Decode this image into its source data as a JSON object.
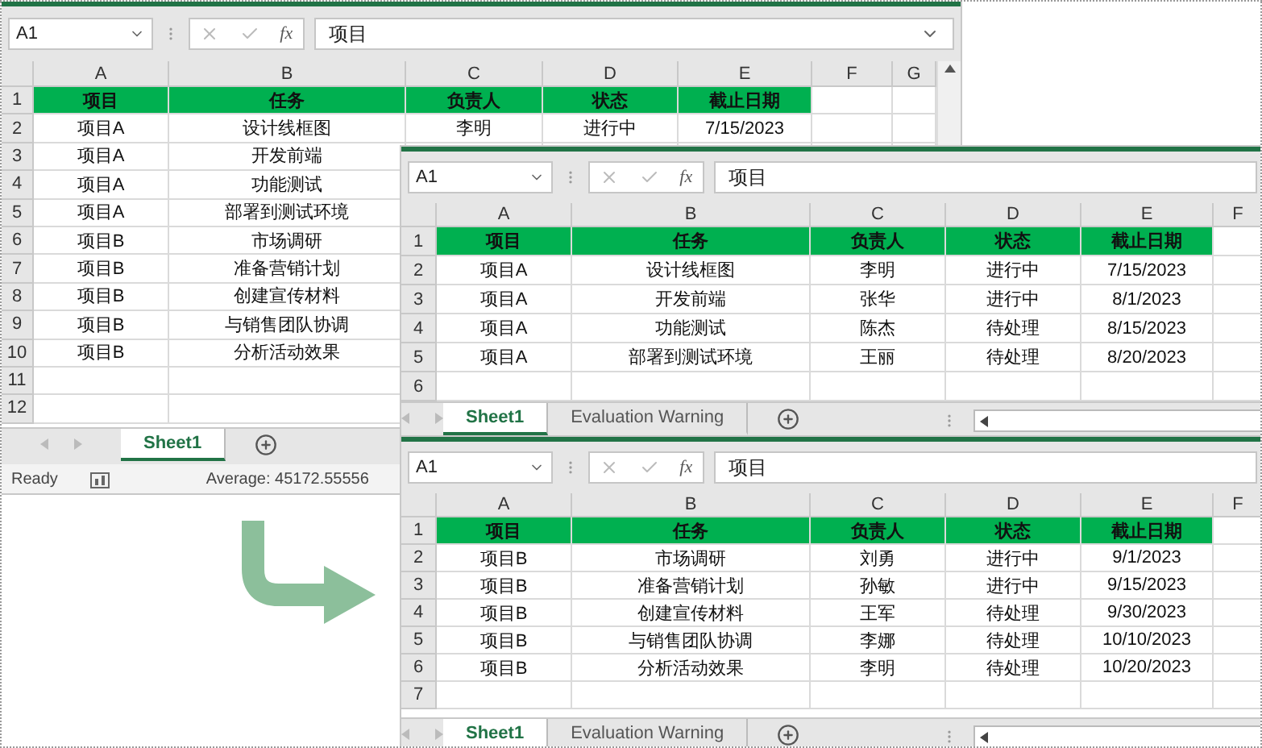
{
  "windows": [
    {
      "formula_bar": {
        "name_box": "A1",
        "function_label": "fx",
        "value": "项目"
      },
      "columns": [
        "A",
        "B",
        "C",
        "D",
        "E",
        "F",
        "G"
      ],
      "rows": [
        {
          "number": "1",
          "kind": "header",
          "cells": [
            "项目",
            "任务",
            "负责人",
            "状态",
            "截止日期"
          ]
        },
        {
          "number": "2",
          "kind": "data",
          "cells": [
            "项目A",
            "设计线框图",
            "李明",
            "进行中",
            "7/15/2023"
          ]
        },
        {
          "number": "3",
          "kind": "data",
          "cells": [
            "项目A",
            "开发前端"
          ]
        },
        {
          "number": "4",
          "kind": "data",
          "cells": [
            "项目A",
            "功能测试"
          ]
        },
        {
          "number": "5",
          "kind": "data",
          "cells": [
            "项目A",
            "部署到测试环境"
          ]
        },
        {
          "number": "6",
          "kind": "data",
          "cells": [
            "项目B",
            "市场调研"
          ]
        },
        {
          "number": "7",
          "kind": "data",
          "cells": [
            "项目B",
            "准备营销计划"
          ]
        },
        {
          "number": "8",
          "kind": "data",
          "cells": [
            "项目B",
            "创建宣传材料"
          ]
        },
        {
          "number": "9",
          "kind": "data",
          "cells": [
            "项目B",
            "与销售团队协调"
          ]
        },
        {
          "number": "10",
          "kind": "data",
          "cells": [
            "项目B",
            "分析活动效果"
          ]
        },
        {
          "number": "11",
          "kind": "data",
          "cells": []
        },
        {
          "number": "12",
          "kind": "data",
          "cells": []
        }
      ],
      "sheet_tabs": [
        {
          "label": "Sheet1",
          "selected": true
        }
      ],
      "status_bar": {
        "mode": "Ready",
        "summary": "Average: 45172.55556"
      }
    },
    {
      "formula_bar": {
        "name_box": "A1",
        "function_label": "fx",
        "value": "项目"
      },
      "columns": [
        "A",
        "B",
        "C",
        "D",
        "E",
        "F"
      ],
      "rows": [
        {
          "number": "1",
          "kind": "header",
          "cells": [
            "项目",
            "任务",
            "负责人",
            "状态",
            "截止日期"
          ]
        },
        {
          "number": "2",
          "kind": "data",
          "cells": [
            "项目A",
            "设计线框图",
            "李明",
            "进行中",
            "7/15/2023"
          ]
        },
        {
          "number": "3",
          "kind": "data",
          "cells": [
            "项目A",
            "开发前端",
            "张华",
            "进行中",
            "8/1/2023"
          ]
        },
        {
          "number": "4",
          "kind": "data",
          "cells": [
            "项目A",
            "功能测试",
            "陈杰",
            "待处理",
            "8/15/2023"
          ]
        },
        {
          "number": "5",
          "kind": "data",
          "cells": [
            "项目A",
            "部署到测试环境",
            "王丽",
            "待处理",
            "8/20/2023"
          ]
        },
        {
          "number": "6",
          "kind": "data",
          "cells": []
        }
      ],
      "sheet_tabs": [
        {
          "label": "Sheet1",
          "selected": true
        },
        {
          "label": "Evaluation Warning",
          "selected": false
        }
      ]
    },
    {
      "formula_bar": {
        "name_box": "A1",
        "function_label": "fx",
        "value": "项目"
      },
      "columns": [
        "A",
        "B",
        "C",
        "D",
        "E",
        "F"
      ],
      "rows": [
        {
          "number": "1",
          "kind": "header",
          "cells": [
            "项目",
            "任务",
            "负责人",
            "状态",
            "截止日期"
          ]
        },
        {
          "number": "2",
          "kind": "data",
          "cells": [
            "项目B",
            "市场调研",
            "刘勇",
            "进行中",
            "9/1/2023"
          ]
        },
        {
          "number": "3",
          "kind": "data",
          "cells": [
            "项目B",
            "准备营销计划",
            "孙敏",
            "进行中",
            "9/15/2023"
          ]
        },
        {
          "number": "4",
          "kind": "data",
          "cells": [
            "项目B",
            "创建宣传材料",
            "王军",
            "待处理",
            "9/30/2023"
          ]
        },
        {
          "number": "5",
          "kind": "data",
          "cells": [
            "项目B",
            "与销售团队协调",
            "李娜",
            "待处理",
            "10/10/2023"
          ]
        },
        {
          "number": "6",
          "kind": "data",
          "cells": [
            "项目B",
            "分析活动效果",
            "李明",
            "待处理",
            "10/20/2023"
          ]
        },
        {
          "number": "7",
          "kind": "data",
          "cells": []
        }
      ],
      "sheet_tabs": [
        {
          "label": "Sheet1",
          "selected": true
        },
        {
          "label": "Evaluation Warning",
          "selected": false
        }
      ]
    }
  ]
}
